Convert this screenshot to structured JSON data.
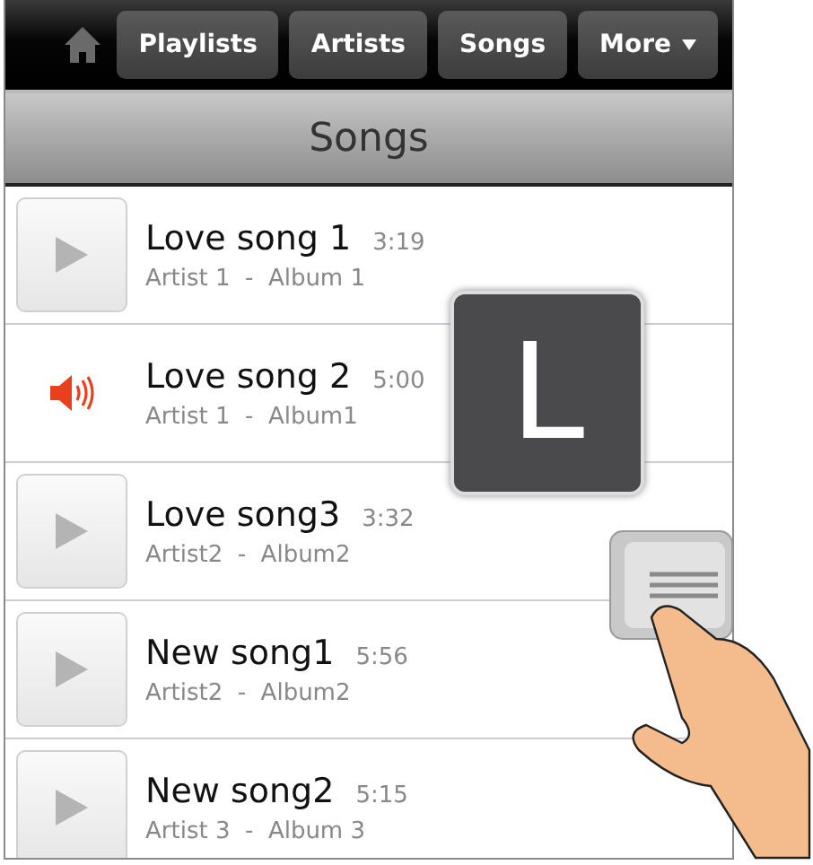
{
  "toolbar": {
    "tabs": [
      {
        "label": "Playlists",
        "has_menu": false
      },
      {
        "label": "Artists",
        "has_menu": false
      },
      {
        "label": "Songs",
        "has_menu": false
      },
      {
        "label": "More",
        "has_menu": true
      }
    ]
  },
  "header": {
    "title": "Songs"
  },
  "songs": [
    {
      "title": "Love song 1",
      "duration": "3:19",
      "subtitle": "Artist 1  -  Album 1",
      "playing": false
    },
    {
      "title": "Love song 2",
      "duration": "5:00",
      "subtitle": "Artist 1  -  Album1",
      "playing": true
    },
    {
      "title": "Love song3",
      "duration": "3:32",
      "subtitle": "Artist2  -  Album2",
      "playing": false
    },
    {
      "title": "New song1",
      "duration": "5:56",
      "subtitle": "Artist2  -  Album2",
      "playing": false
    },
    {
      "title": "New song2",
      "duration": "5:15",
      "subtitle": "Artist 3  -  Album 3",
      "playing": false
    }
  ],
  "index_overlay": {
    "letter": "L"
  }
}
